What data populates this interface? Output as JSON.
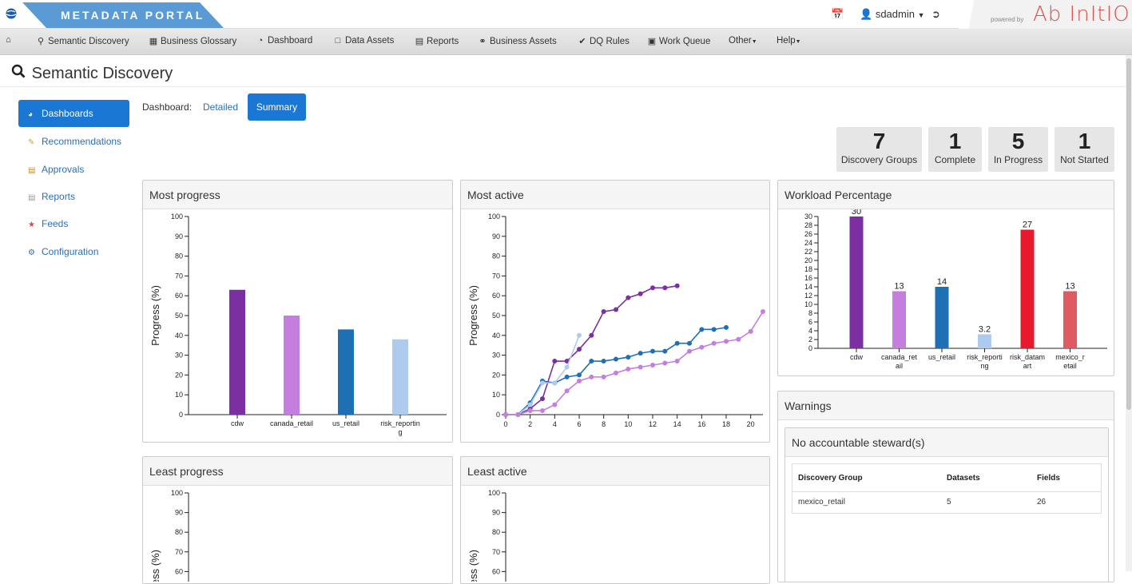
{
  "app": {
    "brand": "METADATA PORTAL",
    "user": "sdadmin",
    "powered_by": "powered by",
    "vendor_logo": "Ab InItIO"
  },
  "nav": [
    {
      "label": "Semantic Discovery",
      "icon": "search-icon"
    },
    {
      "label": "Business Glossary",
      "icon": "book-icon"
    },
    {
      "label": "Dashboard",
      "icon": "dashboard-icon"
    },
    {
      "label": "Data Assets",
      "icon": "folder-icon"
    },
    {
      "label": "Reports",
      "icon": "report-icon"
    },
    {
      "label": "Business Assets",
      "icon": "share-icon"
    },
    {
      "label": "DQ Rules",
      "icon": "check-icon"
    },
    {
      "label": "Work Queue",
      "icon": "inbox-icon"
    },
    {
      "label": "Other",
      "icon": "caret-down-icon"
    },
    {
      "label": "Help",
      "icon": "caret-down-icon"
    }
  ],
  "page": {
    "title": "Semantic Discovery"
  },
  "sidebar": [
    {
      "label": "Dashboards",
      "icon": "pie-chart-icon",
      "active": true
    },
    {
      "label": "Recommendations",
      "icon": "recommendation-icon"
    },
    {
      "label": "Approvals",
      "icon": "approvals-icon"
    },
    {
      "label": "Reports",
      "icon": "reports-icon"
    },
    {
      "label": "Feeds",
      "icon": "feeds-icon"
    },
    {
      "label": "Configuration",
      "icon": "gears-icon"
    }
  ],
  "dashboard": {
    "label": "Dashboard:",
    "detailed": "Detailed",
    "summary": "Summary"
  },
  "stats": [
    {
      "value": "7",
      "label": "Discovery Groups"
    },
    {
      "value": "1",
      "label": "Complete"
    },
    {
      "value": "5",
      "label": "In Progress"
    },
    {
      "value": "1",
      "label": "Not Started"
    }
  ],
  "panels": {
    "most_progress": "Most progress",
    "most_active": "Most active",
    "workload": "Workload Percentage",
    "least_progress": "Least progress",
    "least_active": "Least active",
    "warnings": "Warnings",
    "no_steward": "No accountable steward(s)"
  },
  "warnings_table": {
    "headers": [
      "Discovery Group",
      "Datasets",
      "Fields"
    ],
    "rows": [
      [
        "mexico_retail",
        "5",
        "26"
      ]
    ]
  },
  "colors": {
    "cdw": "#7b2fa0",
    "canada_retail": "#c47ede",
    "us_retail": "#1f6fb5",
    "risk_reporting": "#aecbef",
    "risk_datamart": "#e8192c",
    "mexico_retail": "#e05a63",
    "accent": "#1a78d4"
  },
  "chart_data": [
    {
      "type": "bar",
      "title": "Most progress",
      "ylabel": "Progress (%)",
      "ylim": [
        0,
        100
      ],
      "yticks": [
        0,
        10,
        20,
        30,
        40,
        50,
        60,
        70,
        80,
        90,
        100
      ],
      "categories": [
        "cdw",
        "canada_retail",
        "us_retail",
        "risk_reporting"
      ],
      "category_labels": [
        [
          "cdw"
        ],
        [
          "canada_retail"
        ],
        [
          "us_retail"
        ],
        [
          "risk_reportin",
          "g"
        ]
      ],
      "values": [
        63,
        50,
        43,
        38
      ]
    },
    {
      "type": "line",
      "title": "Most active",
      "ylabel": "Progress (%)",
      "ylim": [
        0,
        100
      ],
      "xlim": [
        0,
        21
      ],
      "xticks": [
        0,
        2,
        4,
        6,
        8,
        10,
        12,
        14,
        16,
        18,
        20
      ],
      "yticks": [
        0,
        10,
        20,
        30,
        40,
        50,
        60,
        70,
        80,
        90,
        100
      ],
      "series": [
        {
          "key": "cdw",
          "x": [
            0,
            1,
            2,
            3,
            4,
            5,
            6,
            7,
            8,
            9,
            10,
            11,
            12,
            13,
            14
          ],
          "y": [
            0,
            0,
            3,
            8,
            27,
            27,
            33,
            40,
            52,
            53,
            59,
            61,
            64,
            64,
            65
          ]
        },
        {
          "key": "us_retail",
          "x": [
            0,
            1,
            2,
            3,
            4,
            5,
            6,
            7,
            8,
            9,
            10,
            11,
            12,
            13,
            14,
            15,
            16,
            17,
            18
          ],
          "y": [
            0,
            0,
            6,
            17,
            16,
            19,
            20,
            27,
            27,
            28,
            29,
            31,
            32,
            32,
            36,
            36,
            43,
            43,
            44
          ]
        },
        {
          "key": "risk_reporting",
          "x": [
            0,
            1,
            2,
            3,
            4,
            5,
            6
          ],
          "y": [
            0,
            0,
            5,
            16,
            16,
            24,
            40
          ]
        },
        {
          "key": "canada_retail",
          "x": [
            0,
            1,
            2,
            3,
            4,
            5,
            6,
            7,
            8,
            9,
            10,
            11,
            12,
            13,
            14,
            15,
            16,
            17,
            18,
            19,
            20,
            21
          ],
          "y": [
            0,
            0,
            2,
            2,
            5,
            12,
            17,
            19,
            19,
            21,
            23,
            24,
            25,
            26,
            27,
            32,
            34,
            36,
            37,
            38,
            42,
            52
          ]
        }
      ]
    },
    {
      "type": "bar",
      "title": "Workload Percentage",
      "ylim": [
        0,
        30
      ],
      "yticks": [
        0,
        2,
        4,
        6,
        8,
        10,
        12,
        14,
        16,
        18,
        20,
        22,
        24,
        26,
        28,
        30
      ],
      "categories": [
        "cdw",
        "canada_retail",
        "us_retail",
        "risk_reporting",
        "risk_datamart",
        "mexico_retail"
      ],
      "category_labels": [
        [
          "cdw"
        ],
        [
          "canada_ret",
          "ail"
        ],
        [
          "us_retail"
        ],
        [
          "risk_reporti",
          "ng"
        ],
        [
          "risk_datam",
          "art"
        ],
        [
          "mexico_r",
          "etail"
        ]
      ],
      "values": [
        30,
        13,
        14,
        3.2,
        27,
        13
      ],
      "data_labels": [
        "30",
        "13",
        "14",
        "3.2",
        "27",
        "13"
      ]
    },
    {
      "type": "bar",
      "title": "Least progress",
      "ylabel": "Progress (%)",
      "ylim": [
        0,
        100
      ],
      "yticks": [
        60,
        70,
        80,
        90,
        100
      ]
    },
    {
      "type": "line",
      "title": "Least active",
      "ylabel": "Progress (%)",
      "ylim": [
        0,
        100
      ],
      "yticks": [
        60,
        70,
        80,
        90,
        100
      ]
    }
  ]
}
